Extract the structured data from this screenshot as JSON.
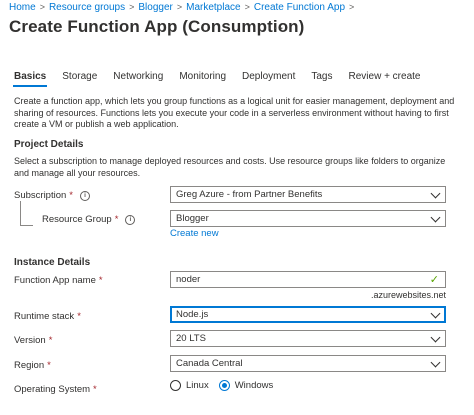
{
  "breadcrumb": [
    "Home",
    "Resource groups",
    "Blogger",
    "Marketplace",
    "Create Function App"
  ],
  "breadcrumb_separator": ">",
  "page_title": "Create Function App (Consumption)",
  "more_label": "···",
  "tabs": [
    "Basics",
    "Storage",
    "Networking",
    "Monitoring",
    "Deployment",
    "Tags",
    "Review + create"
  ],
  "active_tab": "Basics",
  "intro": "Create a function app, which lets you group functions as a logical unit for easier management, deployment and sharing of resources. Functions lets you execute your code in a serverless environment without having to first create a VM or publish a web application.",
  "project_details": {
    "heading": "Project Details",
    "description": "Select a subscription to manage deployed resources and costs. Use resource groups like folders to organize and manage all your resources.",
    "subscription_label": "Subscription",
    "subscription_value": "Greg Azure - from Partner Benefits",
    "resource_group_label": "Resource Group",
    "resource_group_value": "Blogger",
    "create_new": "Create new"
  },
  "instance_details": {
    "heading": "Instance Details",
    "app_name_label": "Function App name",
    "app_name_value": "noder",
    "app_name_suffix": ".azurewebsites.net",
    "runtime_label": "Runtime stack",
    "runtime_value": "Node.js",
    "version_label": "Version",
    "version_value": "20 LTS",
    "region_label": "Region",
    "region_value": "Canada Central",
    "os_label": "Operating System",
    "os_options": [
      "Linux",
      "Windows"
    ],
    "os_selected": "Windows"
  },
  "required_mark": "*",
  "info_icon": "i",
  "check_icon": "✓",
  "colors": {
    "accent": "#0078d4",
    "required": "#a4262c",
    "valid": "#57a300"
  }
}
